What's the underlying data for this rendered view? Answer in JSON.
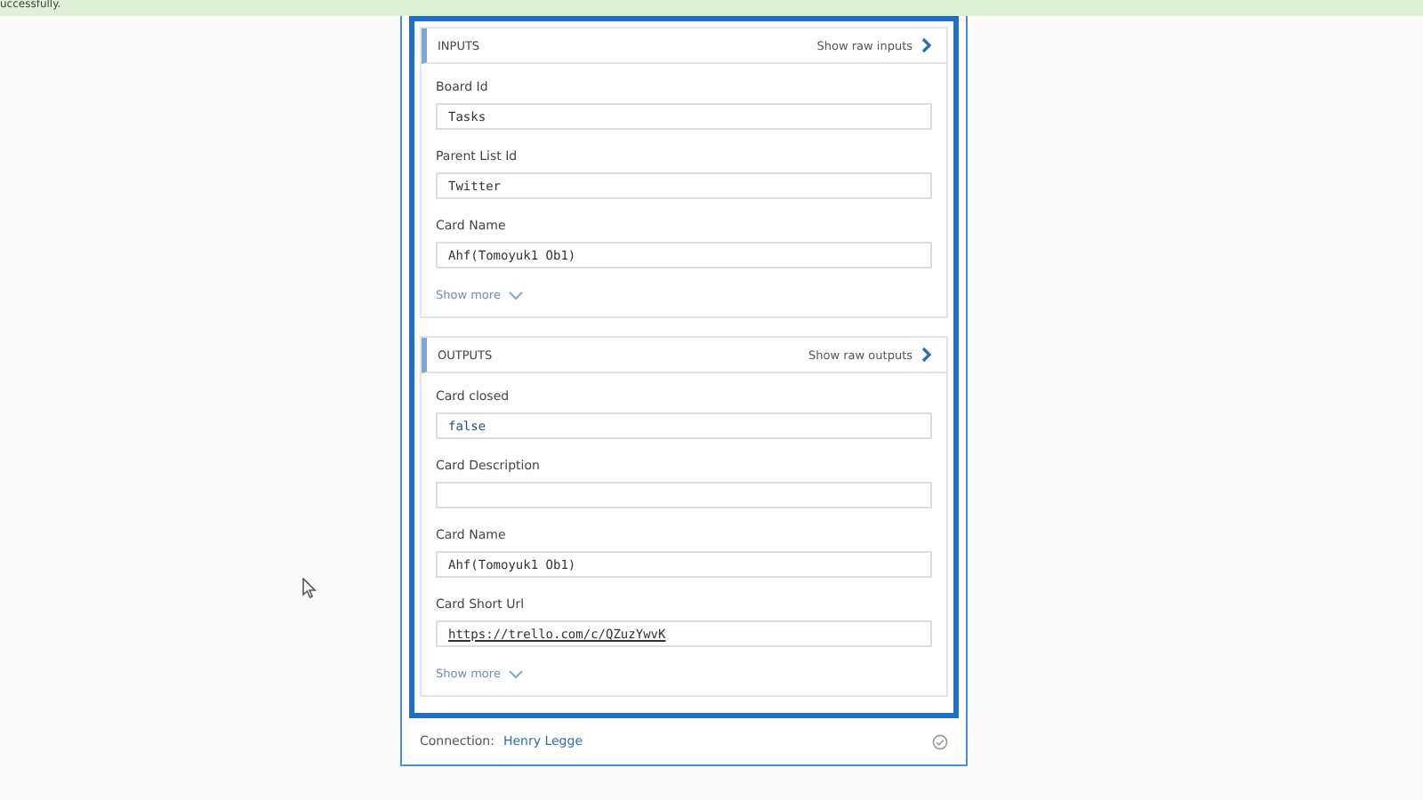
{
  "banner": {
    "text": "uccessfully."
  },
  "sections": [
    {
      "title": "INPUTS",
      "raw_link": "Show raw inputs",
      "show_more": "Show more",
      "fields": [
        {
          "label": "Board Id",
          "value": "Tasks",
          "kind": "text"
        },
        {
          "label": "Parent List Id",
          "value": "Twitter",
          "kind": "text"
        },
        {
          "label": "Card Name",
          "value": "Ahf(Tomoyuk1 Ob1)",
          "kind": "text"
        }
      ]
    },
    {
      "title": "OUTPUTS",
      "raw_link": "Show raw outputs",
      "show_more": "Show more",
      "fields": [
        {
          "label": "Card closed",
          "value": "false",
          "kind": "boolean"
        },
        {
          "label": "Card Description"
        },
        {
          "label": "Card Name",
          "value": "Ahf(Tomoyuk1 Ob1)",
          "kind": "text"
        },
        {
          "label": "Card Short Url",
          "value": "https://trello.com/c/QZuzYwvK",
          "kind": "link"
        }
      ]
    }
  ],
  "connection": {
    "label": "Connection:",
    "name": "Henry Legge"
  }
}
